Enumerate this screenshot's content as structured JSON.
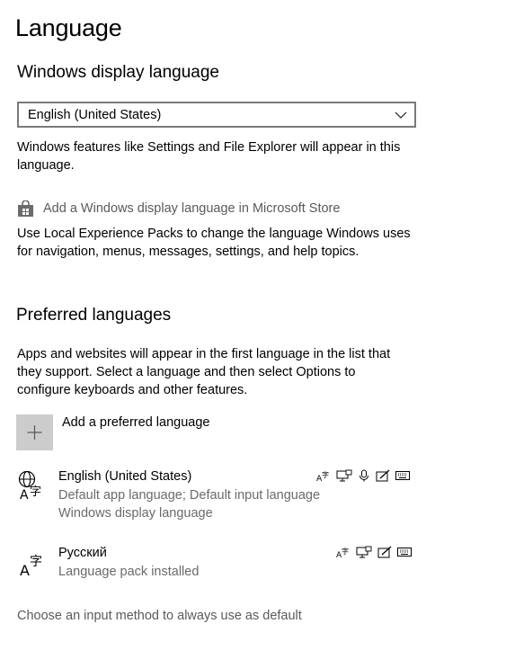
{
  "page": {
    "title": "Language"
  },
  "display_language": {
    "heading": "Windows display language",
    "dropdown_value": "English (United States)",
    "description_line1": "Windows features like Settings and File Explorer will appear in this",
    "description_line2": "language.",
    "store_link": "Add a Windows display language in Microsoft Store",
    "lep_line1": "Use Local Experience Packs to change the language Windows uses",
    "lep_line2": "for navigation, menus, messages, settings, and help topics."
  },
  "preferred": {
    "heading": "Preferred languages",
    "desc_line1": "Apps and websites will appear in the first language in the list that",
    "desc_line2": "they support. Select a language and then select Options to",
    "desc_line3": "configure keyboards and other features.",
    "add_label": "Add a preferred language",
    "languages": [
      {
        "name": "English (United States)",
        "sub1": "Default app language; Default input language",
        "sub2": "Windows display language",
        "features": [
          "language-pack-icon",
          "display-language-icon",
          "speech-icon",
          "handwriting-icon",
          "keyboard-icon"
        ]
      },
      {
        "name": "Русский",
        "sub1": "Language pack installed",
        "features": [
          "language-pack-icon",
          "display-language-icon",
          "handwriting-icon",
          "keyboard-icon"
        ]
      }
    ]
  },
  "footer": {
    "input_method_link": "Choose an input method to always use as default"
  }
}
